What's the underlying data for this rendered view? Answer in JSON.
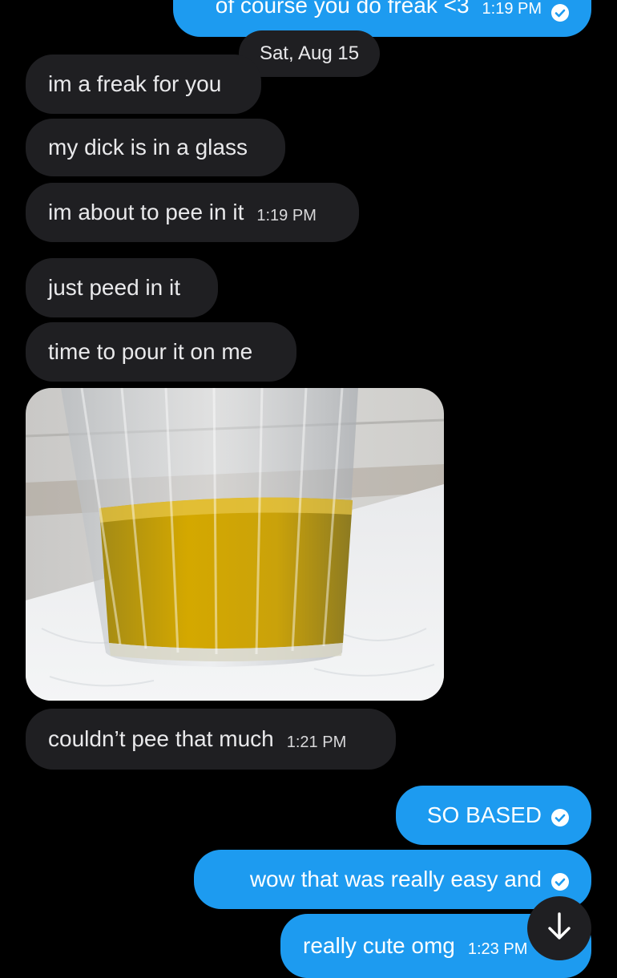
{
  "date_divider": "Sat, Aug 15",
  "messages": {
    "m0": {
      "text": "of course you do freak <3",
      "time": "1:19 PM"
    },
    "m1": {
      "text": "im a freak for you"
    },
    "m2": {
      "text": "my dick is in a glass"
    },
    "m3": {
      "text": "im about to pee in it",
      "time": "1:19 PM"
    },
    "m4": {
      "text": "just peed in it"
    },
    "m5": {
      "text": "time to pour it on me"
    },
    "m6": {
      "text": "couldn’t pee that much",
      "time": "1:21 PM"
    },
    "m7": {
      "text": "SO BASED"
    },
    "m8": {
      "text": "wow that was really easy and"
    },
    "m9": {
      "text": "really cute omg",
      "time": "1:23 PM"
    }
  },
  "icons": {
    "read_receipt": "check-circle-icon",
    "scroll_down": "arrow-down-icon"
  },
  "colors": {
    "outgoing_bubble": "#1d9bf0",
    "incoming_bubble": "#1f1f22",
    "background": "#000000"
  }
}
